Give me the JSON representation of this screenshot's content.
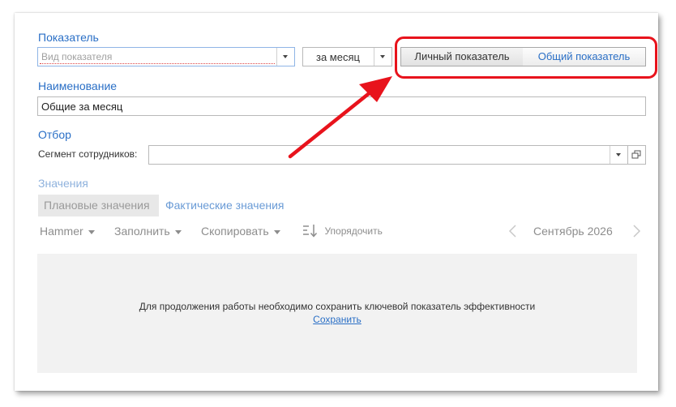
{
  "indicator": {
    "label": "Показатель",
    "kind_placeholder": "Вид показателя",
    "period_value": "за месяц",
    "personal_label": "Личный показатель",
    "general_label": "Общий показатель"
  },
  "name": {
    "label": "Наименование",
    "value": "Общие за месяц"
  },
  "filter": {
    "label": "Отбор",
    "segment_label": "Сегмент сотрудников:",
    "segment_value": ""
  },
  "values": {
    "label": "Значения",
    "tab_planned": "Плановые значения",
    "tab_actual": "Фактические значения"
  },
  "toolbar": {
    "hammer": "Hammer",
    "fill": "Заполнить",
    "copy": "Скопировать",
    "sort": "Упорядочить",
    "period": "Сентябрь 2026"
  },
  "message": {
    "text": "Для продолжения работы необходимо сохранить ключевой показатель эффективности",
    "link": "Сохранить"
  },
  "colors": {
    "accent": "#2a6fc6",
    "annotation": "#e8131c"
  }
}
